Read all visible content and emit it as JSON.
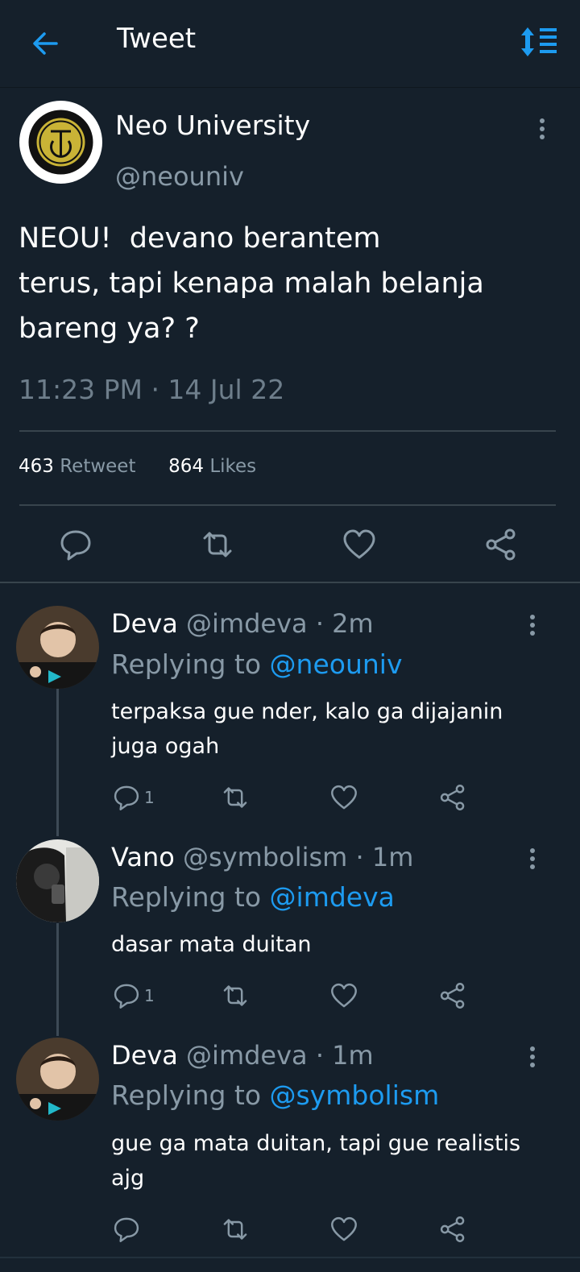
{
  "header": {
    "title": "Tweet",
    "back_icon": "arrow-left-icon",
    "sort_icon": "sort-icon"
  },
  "colors": {
    "background": "#15202b",
    "accent": "#1d9bf0",
    "secondary_text": "#8899a6",
    "divider": "#38444d"
  },
  "main_tweet": {
    "author_name": "Neo University",
    "author_handle": "@neouniv",
    "text": "NEOU!  devano berantem\nterus, tapi kenapa malah belanja\nbareng ya? ?",
    "timestamp": "11:23 PM · 14 Jul 22",
    "retweet_count": "463",
    "retweet_label": "Retweet",
    "like_count": "864",
    "like_label": "Likes"
  },
  "replies": [
    {
      "name": "Deva",
      "handle_time": "@imdeva · 2m",
      "replying_label": "Replying to",
      "replying_to": "@neouniv",
      "text": "terpaksa gue nder, kalo ga dijajanin juga ogah",
      "reply_count": "1"
    },
    {
      "name": "Vano",
      "handle_time": "@symbolism · 1m",
      "replying_label": "Replying to",
      "replying_to": "@imdeva",
      "text": "dasar mata duitan",
      "reply_count": "1"
    },
    {
      "name": "Deva",
      "handle_time": "@imdeva · 1m",
      "replying_label": "Replying to",
      "replying_to": "@symbolism",
      "text": "gue ga mata duitan, tapi gue realistis ajg",
      "reply_count": ""
    }
  ]
}
